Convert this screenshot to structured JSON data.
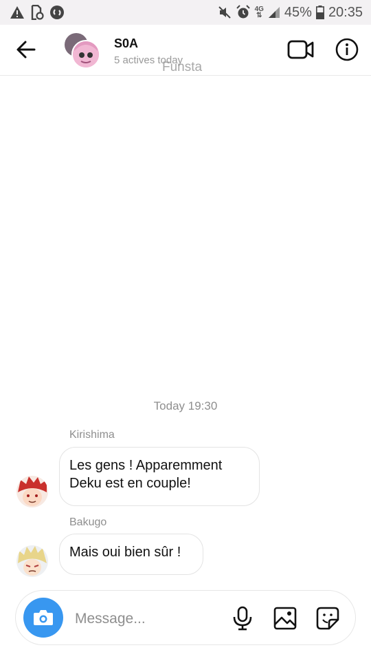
{
  "status_bar": {
    "network": "4G",
    "battery": "45%",
    "time": "20:35"
  },
  "header": {
    "title": "S0A",
    "subtitle": "5 actives today",
    "watermark": "Funsta"
  },
  "conversation": {
    "time_divider": "Today 19:30",
    "messages": [
      {
        "sender": "Kirishima",
        "lines": [
          "Les gens ! Apparemment",
          "Deku est en couple!"
        ]
      },
      {
        "sender": "Bakugo",
        "lines": [
          "Mais oui bien sûr !"
        ]
      }
    ]
  },
  "composer": {
    "placeholder": "Message..."
  },
  "colors": {
    "accent": "#3897f0",
    "status_bar_bg": "#f3f1f3",
    "secondary_text": "#8e8e8e"
  },
  "icons": {
    "status_left": [
      "warning-icon",
      "file-sync-icon",
      "shazam-icon"
    ],
    "status_right": [
      "mute-icon",
      "alarm-icon",
      "signal-icon",
      "battery-icon"
    ],
    "header": [
      "back-arrow-icon",
      "video-call-icon",
      "info-icon"
    ],
    "composer": [
      "camera-icon",
      "microphone-icon",
      "gallery-icon",
      "sticker-icon"
    ]
  }
}
